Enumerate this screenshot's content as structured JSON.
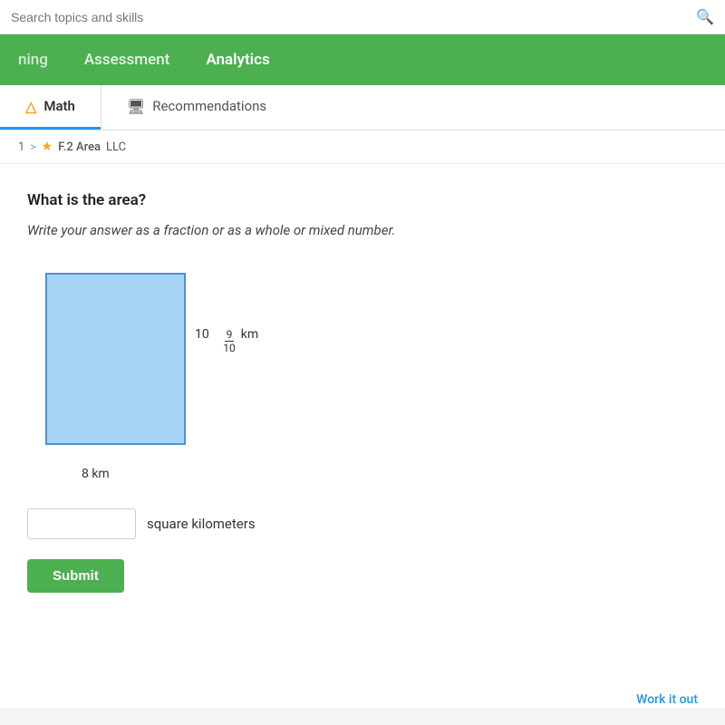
{
  "search": {
    "placeholder": "Search topics and skills"
  },
  "nav": {
    "items": [
      {
        "id": "learning",
        "label": "ning",
        "active": false
      },
      {
        "id": "assessment",
        "label": "Assessment",
        "active": false
      },
      {
        "id": "analytics",
        "label": "Analytics",
        "active": true
      }
    ]
  },
  "tabs": [
    {
      "id": "math",
      "label": "Math",
      "icon": "▲",
      "active": true
    },
    {
      "id": "recommendations",
      "label": "Recommendations",
      "icon": "🖥",
      "active": false
    }
  ],
  "breadcrumb": {
    "number": "1",
    "chevron": ">",
    "star": "★",
    "section": "F.2 Area",
    "tag": "LLC"
  },
  "question": {
    "title": "What is the area?",
    "instruction": "Write your answer as a fraction or as a whole or mixed number."
  },
  "diagram": {
    "side_whole": "10",
    "side_numerator": "9",
    "side_denominator": "10",
    "side_unit": "km",
    "bottom_label": "8 km"
  },
  "answer": {
    "placeholder": "",
    "unit": "square kilometers"
  },
  "buttons": {
    "submit": "Submit",
    "work_it_out": "Work it out"
  }
}
